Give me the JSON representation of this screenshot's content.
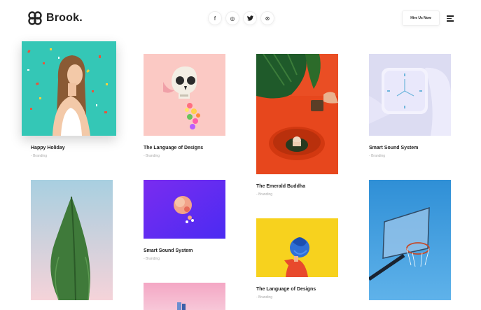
{
  "brand": {
    "name": "Brook."
  },
  "header": {
    "socials": [
      {
        "icon": "facebook-icon",
        "glyph": "f"
      },
      {
        "icon": "instagram-icon",
        "glyph": "◎"
      },
      {
        "icon": "twitter-icon",
        "glyph": "🐦"
      },
      {
        "icon": "dribbble-icon",
        "glyph": "⊛"
      }
    ],
    "hire_label": "Hire Us Now"
  },
  "projects": [
    {
      "title": "Happy Holiday",
      "category": "Branding"
    },
    {
      "title": "The Language of Designs",
      "category": "Branding"
    },
    {
      "title": "The Emerald Buddha",
      "category": "Branding"
    },
    {
      "title": "Smart Sound System",
      "category": "Branding"
    },
    {
      "title": "Smart Sound System",
      "category": "Branding"
    },
    {
      "title": "The Language of Designs",
      "category": "Branding"
    }
  ]
}
